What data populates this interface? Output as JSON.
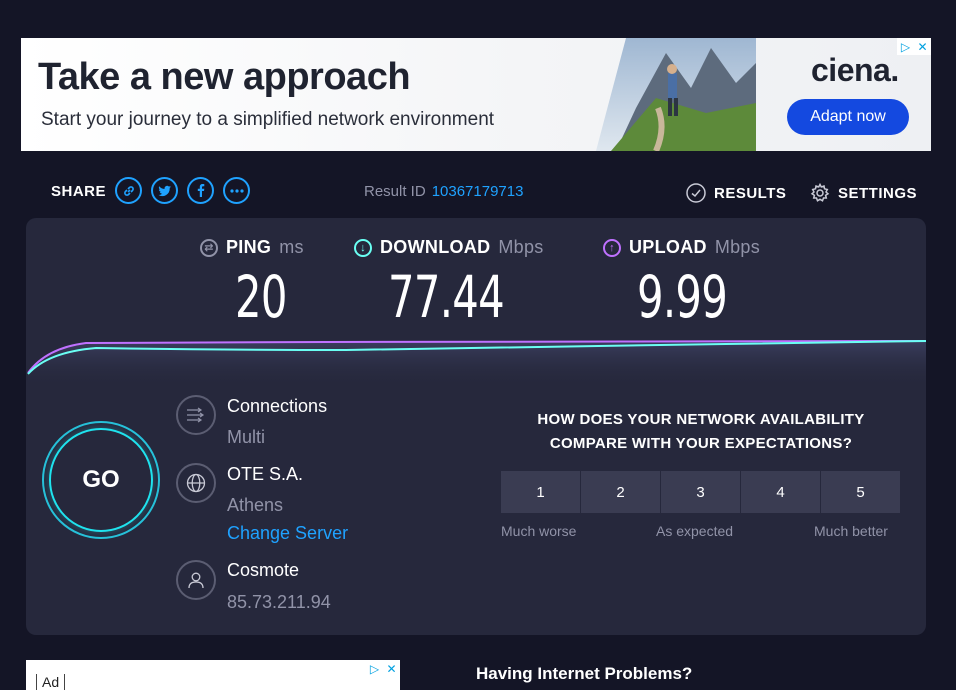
{
  "ad_top": {
    "headline": "Take a new approach",
    "subtext": "Start your journey to a simplified network environment",
    "logo": "ciena.",
    "cta": "Adapt now",
    "choice_icons": [
      "adchoices-icon",
      "close-icon"
    ]
  },
  "header": {
    "share_label": "SHARE",
    "share_icons": [
      "link-icon",
      "twitter-icon",
      "facebook-icon",
      "more-icon"
    ],
    "result_id_label": "Result ID",
    "result_id": "10367179713",
    "results_label": "RESULTS",
    "settings_label": "SETTINGS"
  },
  "metrics": {
    "ping": {
      "label": "PING",
      "unit": "ms",
      "value": "20",
      "color": "#9193a8"
    },
    "download": {
      "label": "DOWNLOAD",
      "unit": "Mbps",
      "value": "77.44",
      "color": "#6afff3"
    },
    "upload": {
      "label": "UPLOAD",
      "unit": "Mbps",
      "value": "9.99",
      "color": "#bf71ff"
    }
  },
  "go_button": "GO",
  "connection": {
    "connections_title": "Connections",
    "connections_value": "Multi",
    "isp_name": "OTE S.A.",
    "server_city": "Athens",
    "change_server": "Change Server",
    "host_name": "Cosmote",
    "ip_address": "85.73.211.94"
  },
  "survey": {
    "question": "HOW DOES YOUR NETWORK AVAILABILITY COMPARE WITH YOUR EXPECTATIONS?",
    "options": [
      "1",
      "2",
      "3",
      "4",
      "5"
    ],
    "label_low": "Much worse",
    "label_mid": "As expected",
    "label_high": "Much better"
  },
  "ad_bottom": {
    "tag": "Ad"
  },
  "bottom_heading": "Having Internet Problems?",
  "colors": {
    "accent": "#1fa2ff",
    "background": "#141526",
    "panel": "#26283c",
    "cta": "#1449e0"
  }
}
